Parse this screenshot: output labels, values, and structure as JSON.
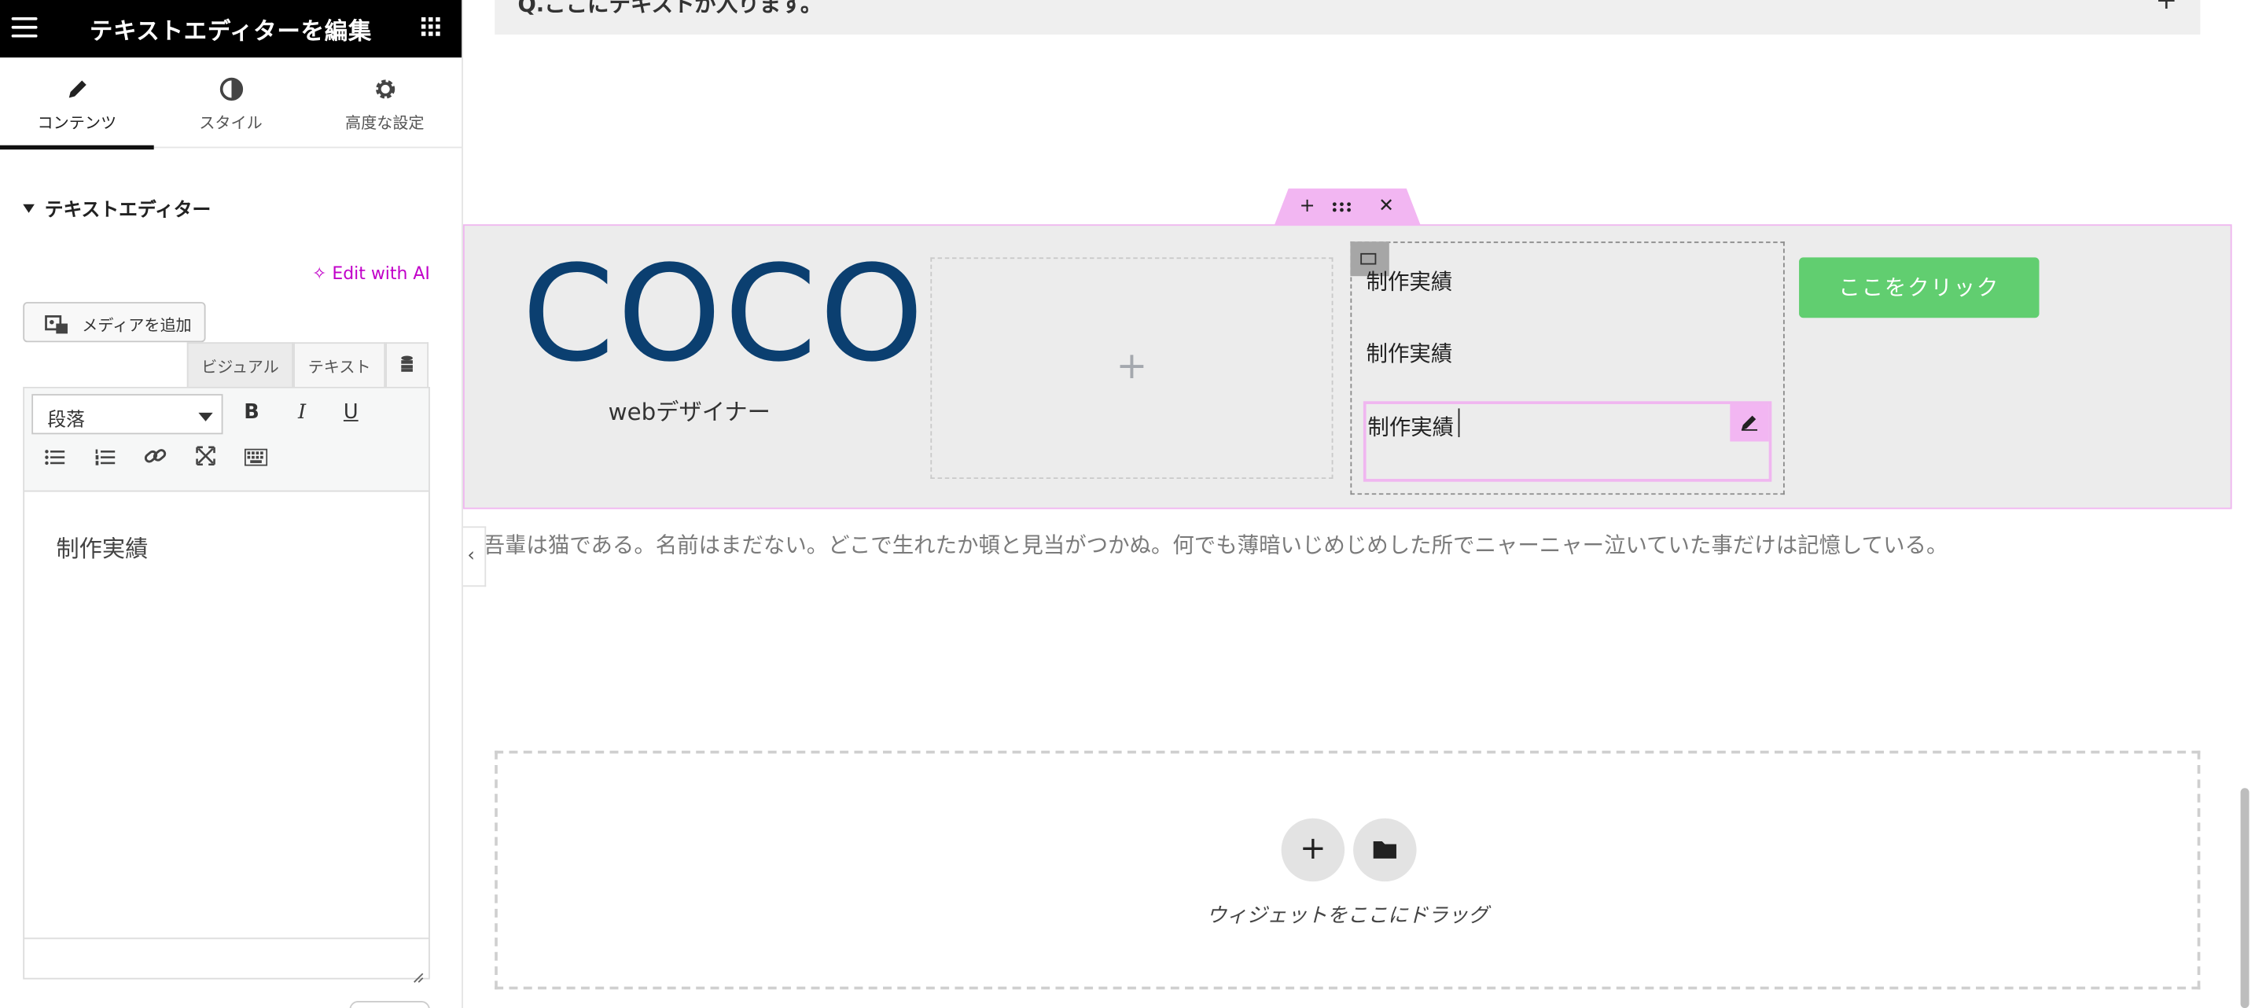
{
  "panel": {
    "title": "テキストエディターを編集",
    "tabs": [
      {
        "label": "コンテンツ",
        "icon": "pencil-icon"
      },
      {
        "label": "スタイル",
        "icon": "contrast-icon"
      },
      {
        "label": "高度な設定",
        "icon": "gear-icon"
      }
    ],
    "section_title": "テキストエディター",
    "edit_ai_label": "Edit with AI",
    "media_button": "メディアを追加",
    "editor_tabs": {
      "visual": "ビジュアル",
      "text": "テキスト"
    },
    "format_select": "段落",
    "editor_content": "制作実績"
  },
  "canvas": {
    "faq_text": "Q.ここにテキストが入ります。",
    "logo_text": "COCO",
    "designer_label": "webデザイナー",
    "list_items": [
      "制作実績",
      "制作実績",
      "制作実績"
    ],
    "cta_label": "ここをクリック",
    "paragraph": "吾輩は猫である。名前はまだない。どこで生れたか頓と見当がつかぬ。何でも薄暗いじめじめした所でニャーニャー泣いていた事だけは記憶している。",
    "drop_zone_text": "ウィジェットをここにドラッグ"
  },
  "colors": {
    "accent_pink": "#f0b6f0",
    "ai_magenta": "#c100c9",
    "logo_navy": "#0b3f70",
    "button_green": "#61ce70"
  }
}
